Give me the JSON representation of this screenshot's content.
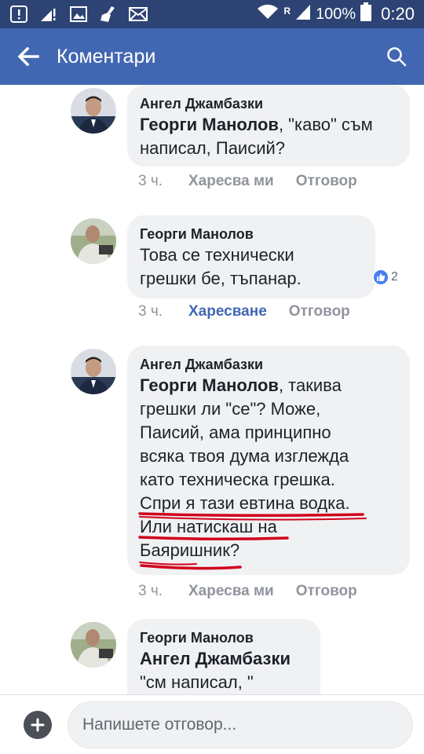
{
  "status_bar": {
    "icons": [
      "alert-icon",
      "signal-alert-icon",
      "image-icon",
      "broom-icon",
      "mail-icon",
      "wifi-icon",
      "cell-signal-icon",
      "battery-icon"
    ],
    "roaming": "R",
    "battery": "100%",
    "time": "0:20"
  },
  "app_bar": {
    "title": "Коментари",
    "back_icon": "arrow-left-icon",
    "search_icon": "search-icon"
  },
  "colors": {
    "status_bar": "#2d4373",
    "app_bar": "#4267b2",
    "bubble": "#f0f1f3",
    "underline": "#d0021b",
    "link": "#4267b2",
    "meta": "#90949c"
  },
  "comments": [
    {
      "author": "Ангел Джамбазки",
      "mention": "Георги Манолов",
      "text_after_mention": ", \"каво\" съм",
      "lines": [
        "написал, Паисий?"
      ],
      "time": "3 ч.",
      "like_label": "Харесва ми",
      "reply_label": "Отговор"
    },
    {
      "author": "Георги Манолов",
      "lines": [
        "Това се технически",
        "грешки бе, тъпанар."
      ],
      "reaction_count": "2",
      "time": "3 ч.",
      "like_label": "Харесване",
      "reply_label": "Отговор"
    },
    {
      "author": "Ангел Джамбазки",
      "mention": "Георги Манолов",
      "text_after_mention": ", такива",
      "lines": [
        "грешки ли \"се\"? Може,",
        "Паисий, ама принципно",
        "всяка твоя дума изглежда",
        "като техническа грешка.",
        "Спри я тази евтина водка.",
        "Или натискаш на",
        "Баяришник?"
      ],
      "time": "3 ч.",
      "like_label": "Харесва ми",
      "reply_label": "Отговор"
    },
    {
      "author": "Георги Манолов",
      "mention": "Ангел Джамбазки",
      "lines": [
        "\"см написал, \""
      ]
    }
  ],
  "reply_bar": {
    "placeholder": "Напишете отговор..."
  }
}
